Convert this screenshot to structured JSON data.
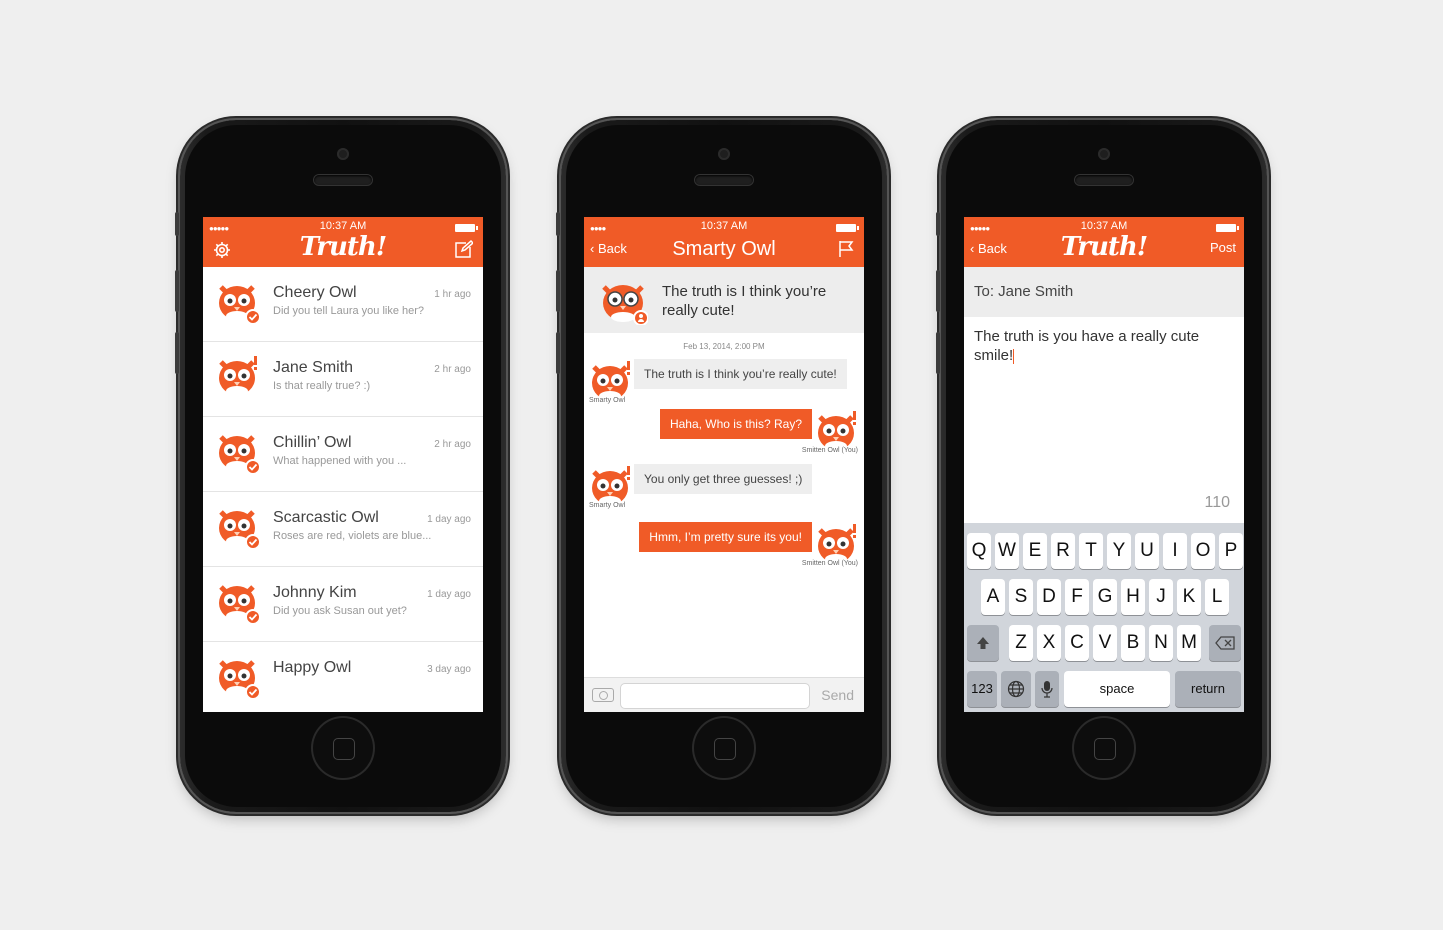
{
  "status": {
    "time": "10:37 AM"
  },
  "colors": {
    "brand": "#f05b27",
    "text": "#444444",
    "muted": "#999999"
  },
  "screen1": {
    "logo": "Truth!",
    "left_icon": "gear-icon",
    "right_icon": "compose-icon",
    "conversations": [
      {
        "name": "Cheery Owl",
        "preview": "Did you tell Laura you like her?",
        "time": "1 hr ago",
        "badge": "check"
      },
      {
        "name": "Jane Smith",
        "preview": "Is that really true? :)",
        "time": "2 hr ago",
        "badge": "exclaim"
      },
      {
        "name": "Chillin’ Owl",
        "preview": "What happened with you ...",
        "time": "2 hr ago",
        "badge": "check"
      },
      {
        "name": "Scarcastic Owl",
        "preview": "Roses are red, violets are blue...",
        "time": "1 day ago",
        "badge": "check"
      },
      {
        "name": "Johnny Kim",
        "preview": "Did you ask Susan out yet?",
        "time": "1 day ago",
        "badge": "check"
      },
      {
        "name": "Happy Owl",
        "preview": "",
        "time": "3 day ago",
        "badge": "check"
      }
    ]
  },
  "screen2": {
    "back": "Back",
    "title": "Smarty Owl",
    "right_icon": "flag-icon",
    "topic": "The truth is I think you’re really cute!",
    "date": "Feb 13, 2014, 2:00 PM",
    "messages": [
      {
        "dir": "in",
        "text": "The truth is I  think you’re really cute!",
        "caption": "Smarty Owl"
      },
      {
        "dir": "out",
        "text": "Haha, Who is this? Ray?",
        "caption": "Smitten  Owl (You)"
      },
      {
        "dir": "in",
        "text": "You only get three guesses! ;)",
        "caption": "Smarty Owl"
      },
      {
        "dir": "out",
        "text": "Hmm, I’m pretty sure its you!",
        "caption": "Smitten  Owl (You)"
      }
    ],
    "send": "Send"
  },
  "screen3": {
    "back": "Back",
    "logo": "Truth!",
    "post": "Post",
    "to": "To: Jane Smith",
    "body": "The truth is you have a really cute smile!",
    "count": "110",
    "keyboard": {
      "row1": [
        "Q",
        "W",
        "E",
        "R",
        "T",
        "Y",
        "U",
        "I",
        "O",
        "P"
      ],
      "row2": [
        "A",
        "S",
        "D",
        "F",
        "G",
        "H",
        "J",
        "K",
        "L"
      ],
      "row3": [
        "Z",
        "X",
        "C",
        "V",
        "B",
        "N",
        "M"
      ],
      "numbers": "123",
      "space": "space",
      "return": "return"
    }
  }
}
